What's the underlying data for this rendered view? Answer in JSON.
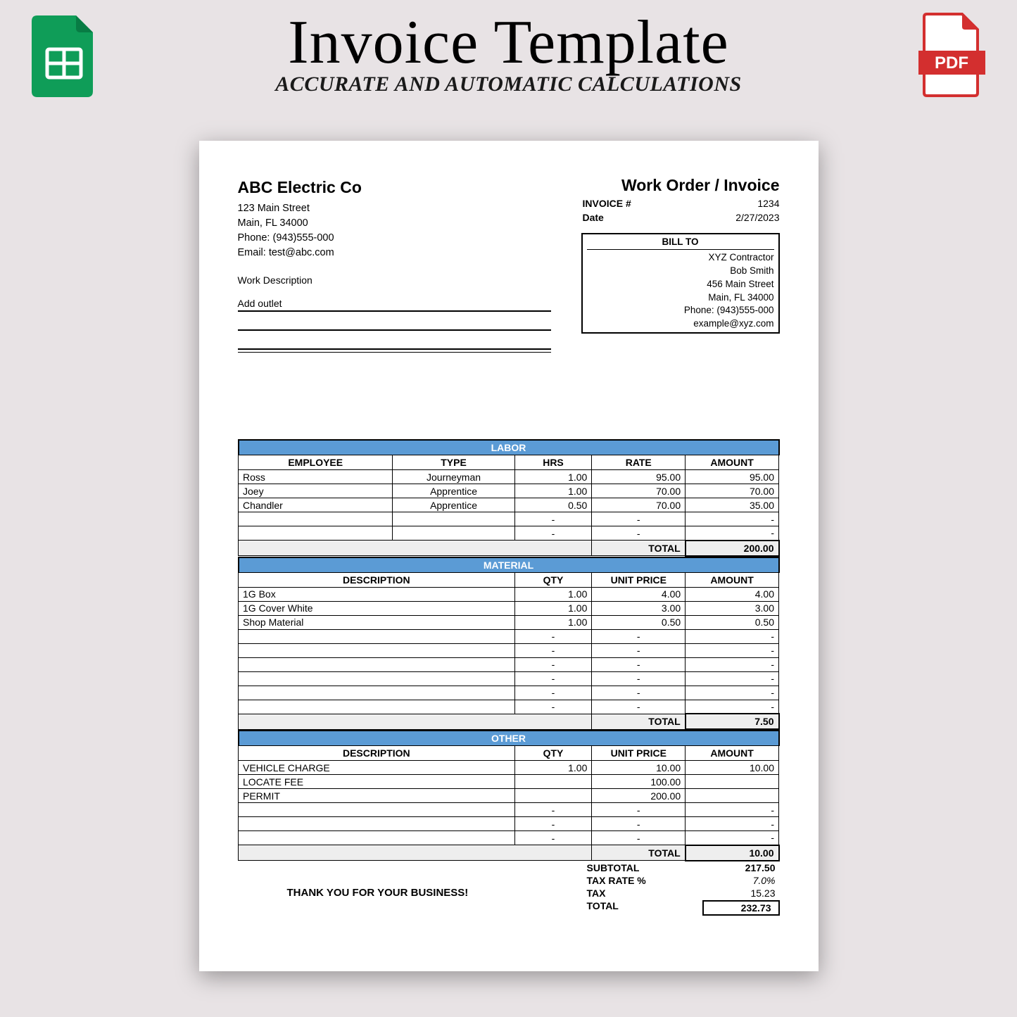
{
  "header": {
    "title": "Invoice Template",
    "subtitle": "ACCURATE AND AUTOMATIC CALCULATIONS"
  },
  "company": {
    "name": "ABC Electric Co",
    "addr1": "123 Main Street",
    "addr2": "Main, FL 34000",
    "phone": "Phone: (943)555-000",
    "email": "Email:  test@abc.com"
  },
  "invoice": {
    "title": "Work Order / Invoice",
    "inv_label": "INVOICE #",
    "inv_num": "1234",
    "date_label": "Date",
    "date": "2/27/2023"
  },
  "billto": {
    "head": "BILL TO",
    "l1": "XYZ Contractor",
    "l2": "Bob Smith",
    "l3": "456 Main Street",
    "l4": "Main, FL 34000",
    "l5": "Phone: (943)555-000",
    "l6": "example@xyz.com"
  },
  "work": {
    "label": "Work Description",
    "line1": "Add outlet"
  },
  "labor": {
    "section": "LABOR",
    "cols": {
      "c1": "EMPLOYEE",
      "c2": "TYPE",
      "c3": "HRS",
      "c4": "RATE",
      "c5": "AMOUNT"
    },
    "r0": {
      "emp": "Ross",
      "type": "Journeyman",
      "hrs": "1.00",
      "rate": "95.00",
      "amt": "95.00"
    },
    "r1": {
      "emp": "Joey",
      "type": "Apprentice",
      "hrs": "1.00",
      "rate": "70.00",
      "amt": "70.00"
    },
    "r2": {
      "emp": "Chandler",
      "type": "Apprentice",
      "hrs": "0.50",
      "rate": "70.00",
      "amt": "35.00"
    },
    "dash": "-",
    "total_label": "TOTAL",
    "total": "200.00"
  },
  "material": {
    "section": "MATERIAL",
    "cols": {
      "c1": "DESCRIPTION",
      "c2": "QTY",
      "c3": "UNIT PRICE",
      "c4": "AMOUNT"
    },
    "r0": {
      "d": "1G Box",
      "q": "1.00",
      "p": "4.00",
      "a": "4.00"
    },
    "r1": {
      "d": "1G Cover White",
      "q": "1.00",
      "p": "3.00",
      "a": "3.00"
    },
    "r2": {
      "d": "Shop Material",
      "q": "1.00",
      "p": "0.50",
      "a": "0.50"
    },
    "dash": "-",
    "total_label": "TOTAL",
    "total": "7.50"
  },
  "other": {
    "section": "OTHER",
    "cols": {
      "c1": "DESCRIPTION",
      "c2": "QTY",
      "c3": "UNIT PRICE",
      "c4": "AMOUNT"
    },
    "r0": {
      "d": "VEHICLE CHARGE",
      "q": "1.00",
      "p": "10.00",
      "a": "10.00"
    },
    "r1": {
      "d": "LOCATE FEE",
      "q": "",
      "p": "100.00",
      "a": ""
    },
    "r2": {
      "d": "PERMIT",
      "q": "",
      "p": "200.00",
      "a": ""
    },
    "dash": "-",
    "total_label": "TOTAL",
    "total": "10.00"
  },
  "summary": {
    "sub_label": "SUBTOTAL",
    "sub": "217.50",
    "taxr_label": "TAX RATE %",
    "taxr": "7.0%",
    "tax_label": "TAX",
    "tax": "15.23",
    "tot_label": "TOTAL",
    "tot": "232.73"
  },
  "thank": "THANK YOU FOR YOUR BUSINESS!"
}
